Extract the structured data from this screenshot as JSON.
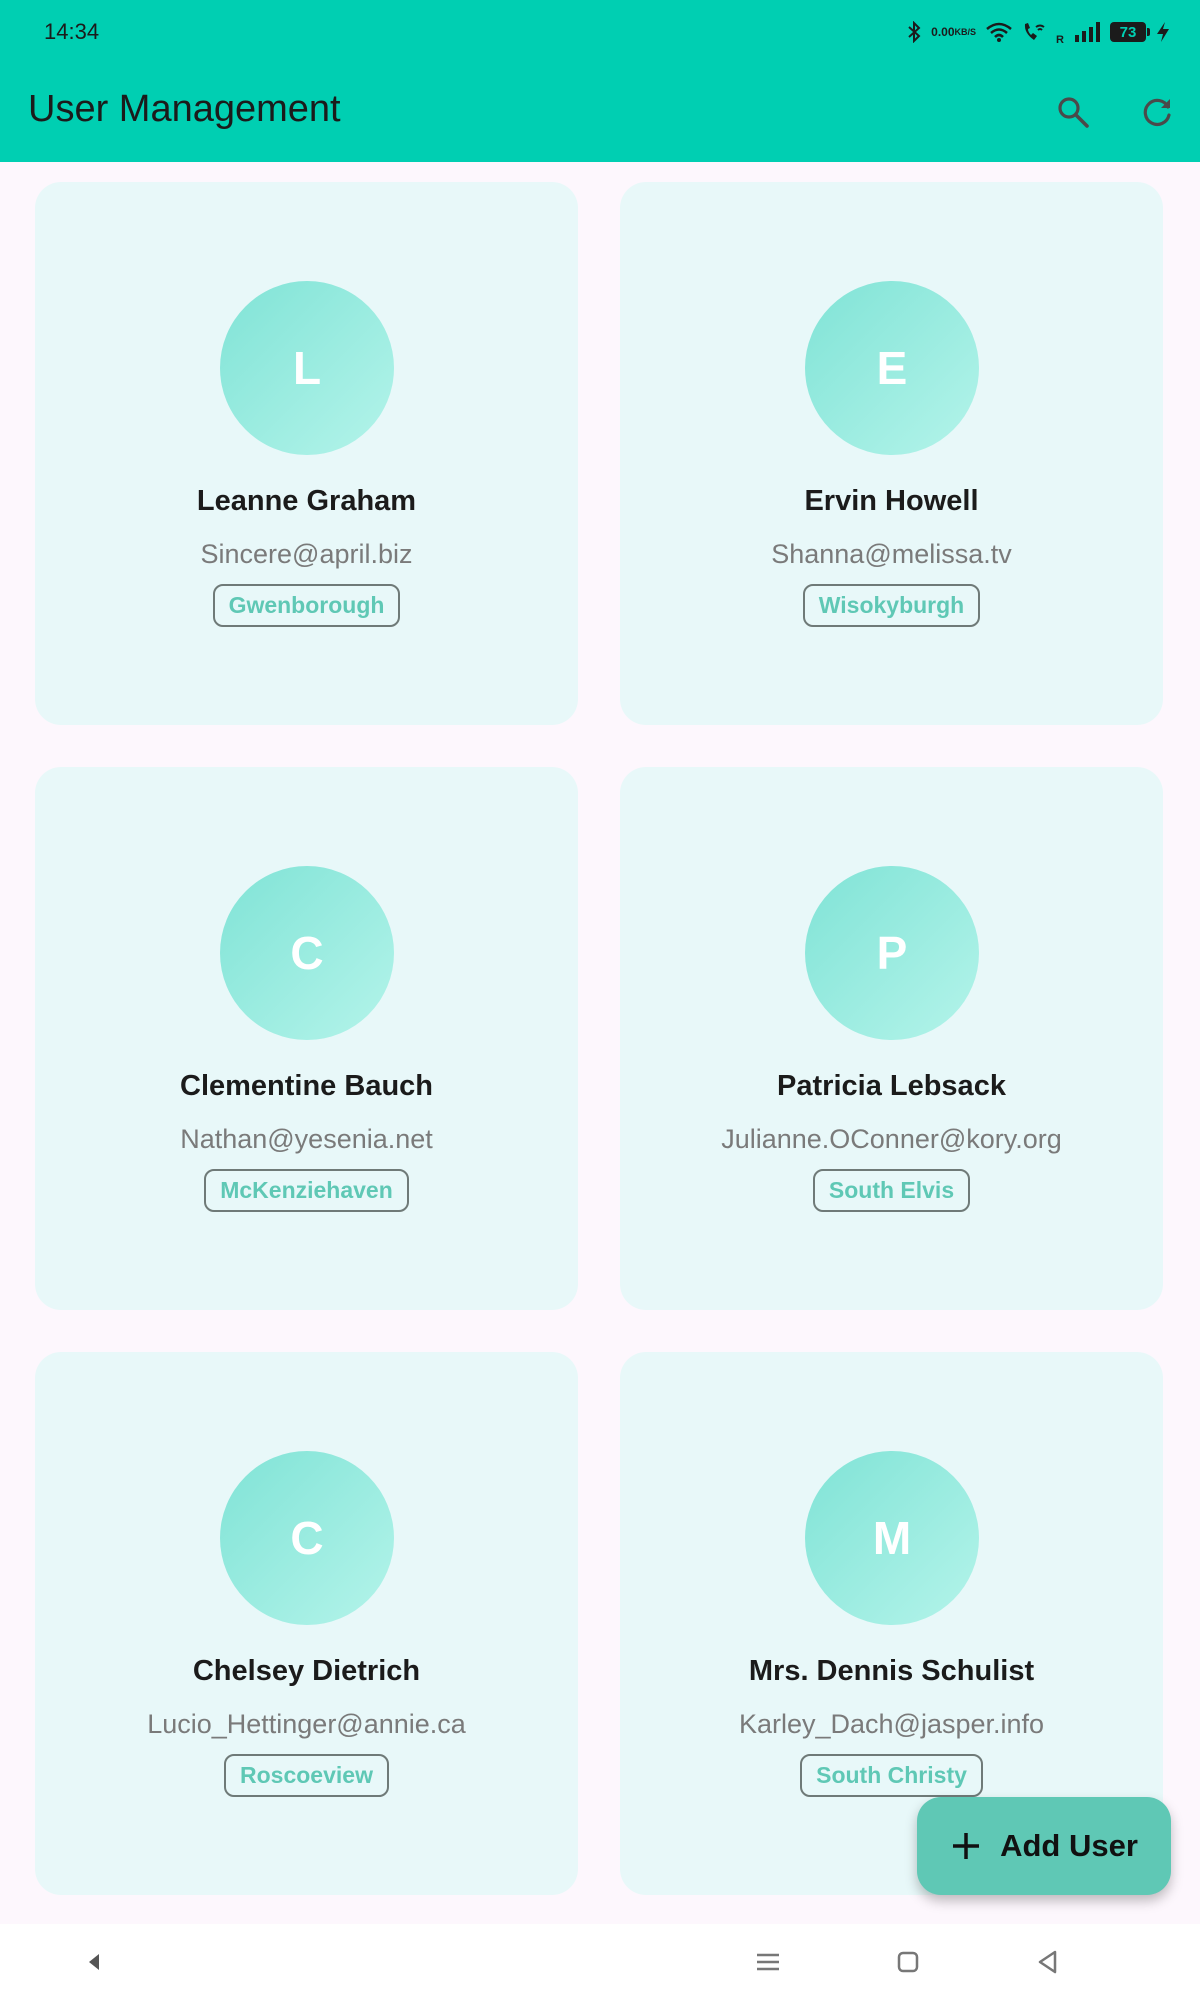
{
  "status_bar": {
    "time": "14:34",
    "net_speed_top": "0.00",
    "net_speed_bottom": "KB/S",
    "roaming": "R",
    "battery": "73",
    "icons": [
      "bluetooth-icon",
      "wifi-icon",
      "wifi-call-icon",
      "signal-icon",
      "battery-icon",
      "charging-icon"
    ]
  },
  "app_bar": {
    "title": "User Management",
    "actions": [
      "search-icon",
      "refresh-icon"
    ]
  },
  "users": [
    {
      "initial": "L",
      "name": "Leanne Graham",
      "email": "Sincere@april.biz",
      "city": "Gwenborough"
    },
    {
      "initial": "E",
      "name": "Ervin Howell",
      "email": "Shanna@melissa.tv",
      "city": "Wisokyburgh"
    },
    {
      "initial": "C",
      "name": "Clementine Bauch",
      "email": "Nathan@yesenia.net",
      "city": "McKenziehaven"
    },
    {
      "initial": "P",
      "name": "Patricia Lebsack",
      "email": "Julianne.OConner@kory.org",
      "city": "South Elvis"
    },
    {
      "initial": "C",
      "name": "Chelsey Dietrich",
      "email": "Lucio_Hettinger@annie.ca",
      "city": "Roscoeview"
    },
    {
      "initial": "M",
      "name": "Mrs. Dennis Schulist",
      "email": "Karley_Dach@jasper.info",
      "city": "South Christy"
    }
  ],
  "fab": {
    "label": "Add User",
    "icon": "plus-icon"
  },
  "nav_bar": {
    "buttons": [
      "back-arrow-icon",
      "menu-icon",
      "home-icon",
      "back-icon"
    ]
  },
  "colors": {
    "app_bar": "#00cfb2",
    "card": "#e8f8f9",
    "accent": "#5fc8b5",
    "background": "#fdf7fd"
  }
}
